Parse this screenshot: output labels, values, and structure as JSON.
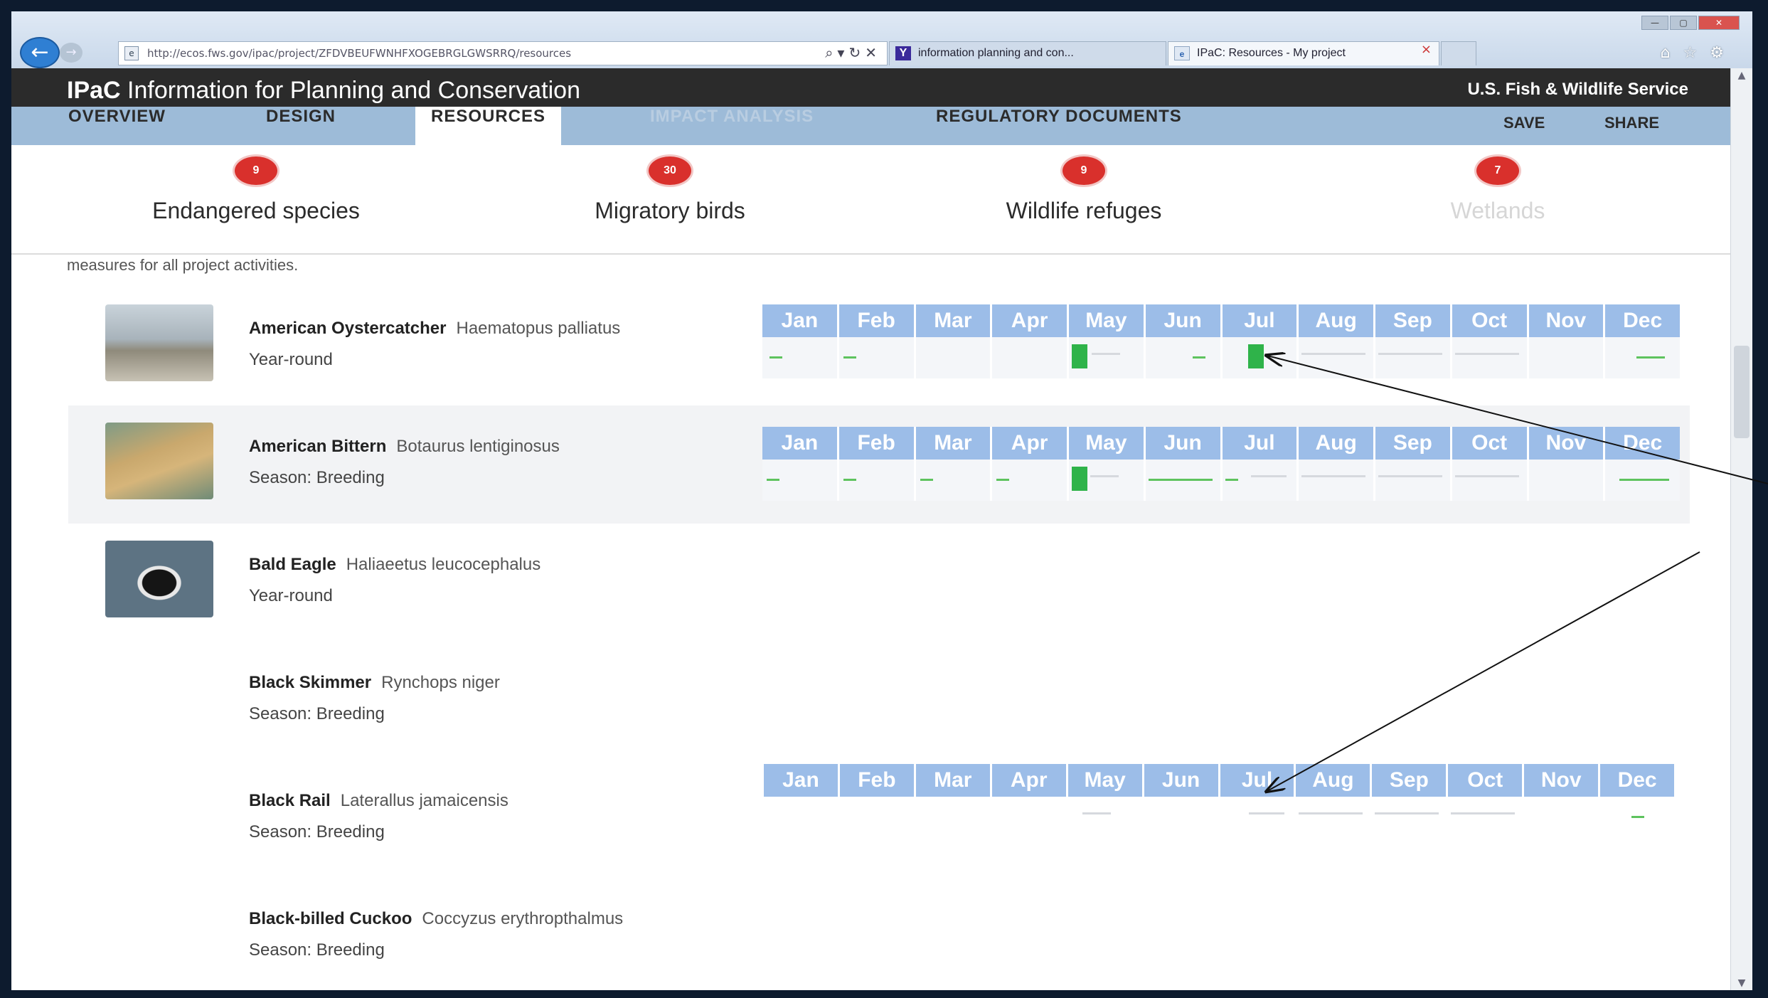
{
  "browser": {
    "url": "http://ecos.fws.gov/ipac/project/ZFDVBEUFWNHFXOGEBRGLGWSRRQ/resources",
    "window_controls": [
      "—",
      "▢",
      "✕"
    ],
    "tabs": [
      {
        "title": "information planning and con...",
        "icon": "Y"
      },
      {
        "title": "IPaC: Resources - My project",
        "icon": "e"
      },
      {
        "title": ""
      }
    ]
  },
  "header": {
    "brand_short": "IPaC",
    "brand_full": "Information for Planning and Conservation",
    "agency": "U.S. Fish & Wildlife Service"
  },
  "nav": {
    "items": [
      "OVERVIEW",
      "DESIGN",
      "RESOURCES",
      "IMPACT ANALYSIS",
      "REGULATORY DOCUMENTS"
    ],
    "active": "RESOURCES",
    "disabled": "IMPACT ANALYSIS",
    "save": "SAVE",
    "share": "SHARE"
  },
  "categories": [
    {
      "label": "Endangered species",
      "count": "9"
    },
    {
      "label": "Migratory birds",
      "count": "30"
    },
    {
      "label": "Wildlife refuges",
      "count": "9"
    },
    {
      "label": "Wetlands",
      "count": "7"
    }
  ],
  "intro_text": "measures for all project activities.",
  "months": [
    "Jan",
    "Feb",
    "Mar",
    "Apr",
    "May",
    "Jun",
    "Jul",
    "Aug",
    "Sep",
    "Oct",
    "Nov",
    "Dec"
  ],
  "birds": [
    {
      "common": "American Oystercatcher",
      "scientific": "Haematopus palliatus",
      "season": "Year-round"
    },
    {
      "common": "American Bittern",
      "scientific": "Botaurus lentiginosus",
      "season": "Season: Breeding"
    },
    {
      "common": "Bald Eagle",
      "scientific": "Haliaeetus leucocephalus",
      "season": "Year-round"
    },
    {
      "common": "Black Skimmer",
      "scientific": "Rynchops niger",
      "season": "Season: Breeding"
    },
    {
      "common": "Black Rail",
      "scientific": "Laterallus jamaicensis",
      "season": "Season: Breeding"
    },
    {
      "common": "Black-billed Cuckoo",
      "scientific": "Coccyzus erythropthalmus",
      "season": "Season: Breeding"
    }
  ],
  "colors": {
    "presence_bar": "#2fb34a",
    "calendar_header": "#9cbde8",
    "badge": "#d9302c",
    "app_bar": "#2b2b2b"
  }
}
